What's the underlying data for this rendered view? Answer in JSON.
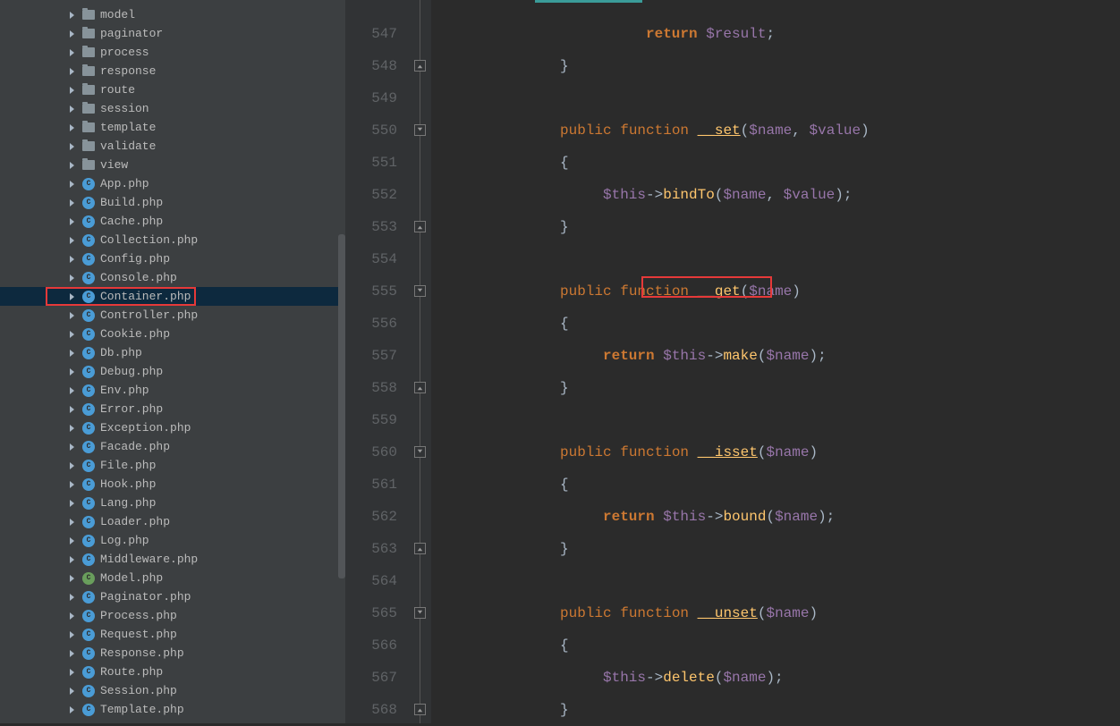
{
  "tree": {
    "folders": [
      "model",
      "paginator",
      "process",
      "response",
      "route",
      "session",
      "template",
      "validate",
      "view"
    ],
    "files": [
      "App.php",
      "Build.php",
      "Cache.php",
      "Collection.php",
      "Config.php",
      "Console.php",
      "Container.php",
      "Controller.php",
      "Cookie.php",
      "Db.php",
      "Debug.php",
      "Env.php",
      "Error.php",
      "Exception.php",
      "Facade.php",
      "File.php",
      "Hook.php",
      "Lang.php",
      "Loader.php",
      "Log.php",
      "Middleware.php",
      "Model.php",
      "Paginator.php",
      "Process.php",
      "Request.php",
      "Response.php",
      "Route.php",
      "Session.php",
      "Template.php"
    ],
    "activeFile": "Container.php",
    "specialIconFile": "Model.php"
  },
  "code": {
    "lines": [
      {
        "n": "547",
        "segs": [
          {
            "indent": 20,
            "t": "return",
            "c": "k-return"
          },
          {
            "t": " "
          },
          {
            "t": "$result",
            "c": "var"
          },
          {
            "t": ";",
            "c": "punct"
          }
        ],
        "fold": null
      },
      {
        "n": "548",
        "segs": [
          {
            "indent": 12,
            "t": "}",
            "c": "punct"
          }
        ],
        "fold": "end"
      },
      {
        "n": "549",
        "segs": [],
        "fold": null
      },
      {
        "n": "550",
        "segs": [
          {
            "indent": 12,
            "t": "public",
            "c": "k-public"
          },
          {
            "t": " "
          },
          {
            "t": "function",
            "c": "k-function"
          },
          {
            "t": " "
          },
          {
            "t": "__set",
            "c": "fn-magic"
          },
          {
            "t": "(",
            "c": "punct"
          },
          {
            "t": "$name",
            "c": "var"
          },
          {
            "t": ", ",
            "c": "punct"
          },
          {
            "t": "$value",
            "c": "var"
          },
          {
            "t": ")",
            "c": "punct"
          }
        ],
        "fold": "start"
      },
      {
        "n": "551",
        "segs": [
          {
            "indent": 12,
            "t": "{",
            "c": "punct"
          }
        ],
        "fold": null
      },
      {
        "n": "552",
        "segs": [
          {
            "indent": 16,
            "t": "$this",
            "c": "var"
          },
          {
            "t": "->",
            "c": "arrow-op"
          },
          {
            "t": "bindTo",
            "c": "method"
          },
          {
            "t": "(",
            "c": "punct"
          },
          {
            "t": "$name",
            "c": "var"
          },
          {
            "t": ", ",
            "c": "punct"
          },
          {
            "t": "$value",
            "c": "var"
          },
          {
            "t": ");",
            "c": "punct"
          }
        ],
        "fold": null
      },
      {
        "n": "553",
        "segs": [
          {
            "indent": 12,
            "t": "}",
            "c": "punct"
          }
        ],
        "fold": "end"
      },
      {
        "n": "554",
        "segs": [],
        "fold": null
      },
      {
        "n": "555",
        "segs": [
          {
            "indent": 12,
            "t": "public",
            "c": "k-public"
          },
          {
            "t": " "
          },
          {
            "t": "function",
            "c": "k-function"
          },
          {
            "t": " "
          },
          {
            "t": "__get",
            "c": "fn-magic"
          },
          {
            "t": "(",
            "c": "punct"
          },
          {
            "t": "$name",
            "c": "var"
          },
          {
            "t": ")",
            "c": "punct"
          }
        ],
        "fold": "start"
      },
      {
        "n": "556",
        "segs": [
          {
            "indent": 12,
            "t": "{",
            "c": "punct"
          }
        ],
        "fold": null
      },
      {
        "n": "557",
        "segs": [
          {
            "indent": 16,
            "t": "return",
            "c": "k-return"
          },
          {
            "t": " "
          },
          {
            "t": "$this",
            "c": "var"
          },
          {
            "t": "->",
            "c": "arrow-op"
          },
          {
            "t": "make",
            "c": "method"
          },
          {
            "t": "(",
            "c": "punct"
          },
          {
            "t": "$name",
            "c": "var"
          },
          {
            "t": ");",
            "c": "punct"
          }
        ],
        "fold": null
      },
      {
        "n": "558",
        "segs": [
          {
            "indent": 12,
            "t": "}",
            "c": "punct"
          }
        ],
        "fold": "end"
      },
      {
        "n": "559",
        "segs": [],
        "fold": null
      },
      {
        "n": "560",
        "segs": [
          {
            "indent": 12,
            "t": "public",
            "c": "k-public"
          },
          {
            "t": " "
          },
          {
            "t": "function",
            "c": "k-function"
          },
          {
            "t": " "
          },
          {
            "t": "__isset",
            "c": "fn-magic"
          },
          {
            "t": "(",
            "c": "punct"
          },
          {
            "t": "$name",
            "c": "var"
          },
          {
            "t": ")",
            "c": "punct"
          }
        ],
        "fold": "start"
      },
      {
        "n": "561",
        "segs": [
          {
            "indent": 12,
            "t": "{",
            "c": "punct"
          }
        ],
        "fold": null
      },
      {
        "n": "562",
        "segs": [
          {
            "indent": 16,
            "t": "return",
            "c": "k-return"
          },
          {
            "t": " "
          },
          {
            "t": "$this",
            "c": "var"
          },
          {
            "t": "->",
            "c": "arrow-op"
          },
          {
            "t": "bound",
            "c": "method"
          },
          {
            "t": "(",
            "c": "punct"
          },
          {
            "t": "$name",
            "c": "var"
          },
          {
            "t": ");",
            "c": "punct"
          }
        ],
        "fold": null
      },
      {
        "n": "563",
        "segs": [
          {
            "indent": 12,
            "t": "}",
            "c": "punct"
          }
        ],
        "fold": "end"
      },
      {
        "n": "564",
        "segs": [],
        "fold": null
      },
      {
        "n": "565",
        "segs": [
          {
            "indent": 12,
            "t": "public",
            "c": "k-public"
          },
          {
            "t": " "
          },
          {
            "t": "function",
            "c": "k-function"
          },
          {
            "t": " "
          },
          {
            "t": "__unset",
            "c": "fn-magic"
          },
          {
            "t": "(",
            "c": "punct"
          },
          {
            "t": "$name",
            "c": "var"
          },
          {
            "t": ")",
            "c": "punct"
          }
        ],
        "fold": "start"
      },
      {
        "n": "566",
        "segs": [
          {
            "indent": 12,
            "t": "{",
            "c": "punct"
          }
        ],
        "fold": null
      },
      {
        "n": "567",
        "segs": [
          {
            "indent": 16,
            "t": "$this",
            "c": "var"
          },
          {
            "t": "->",
            "c": "arrow-op"
          },
          {
            "t": "delete",
            "c": "method"
          },
          {
            "t": "(",
            "c": "punct"
          },
          {
            "t": "$name",
            "c": "var"
          },
          {
            "t": ");",
            "c": "punct"
          }
        ],
        "fold": null
      },
      {
        "n": "568",
        "segs": [
          {
            "indent": 12,
            "t": "}",
            "c": "punct"
          }
        ],
        "fold": "end"
      }
    ]
  },
  "icons": {
    "php": "C",
    "class": "C"
  }
}
